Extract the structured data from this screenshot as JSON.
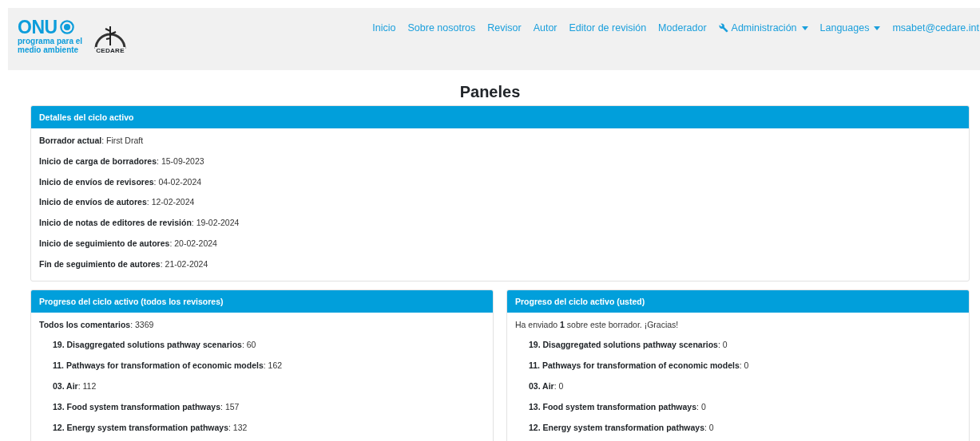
{
  "header": {
    "logo_primary": {
      "title": "ONU",
      "subtitle": "programa para el medio ambiente"
    },
    "logo_secondary": {
      "caption": "CEDARE"
    },
    "nav": [
      {
        "label": "Inicio",
        "kind": "link"
      },
      {
        "label": "Sobre nosotros",
        "kind": "link"
      },
      {
        "label": "Revisor",
        "kind": "link"
      },
      {
        "label": "Autor",
        "kind": "link"
      },
      {
        "label": "Editor de revisión",
        "kind": "link"
      },
      {
        "label": "Moderador",
        "kind": "link"
      },
      {
        "label": "Administración",
        "kind": "admin"
      },
      {
        "label": "Languages",
        "kind": "dropdown"
      },
      {
        "label": "msabet@cedare.int",
        "kind": "dropdown"
      }
    ]
  },
  "page_title": "Paneles",
  "cycle_details": {
    "title": "Detalles del ciclo activo",
    "rows": [
      "**Borrador actual**: First Draft",
      "**Inicio de carga de borradores**: 15-09-2023",
      "**Inicio de envíos de revisores**: 04-02-2024",
      "**Inicio de envíos de autores**: 12-02-2024",
      "**Inicio de notas de editores de revisión**: 19-02-2024",
      "**Inicio de seguimiento de autores**: 20-02-2024",
      "**Fin de seguimiento de autores**: 21-02-2024"
    ]
  },
  "progress_panels": [
    {
      "title": "Progreso del ciclo activo (todos los revisores)",
      "summary": "**Todos los comentarios**: 3369",
      "chapters": [
        "**19. Disaggregated solutions pathway scenarios**: 60",
        "**11. Pathways for transformation of economic models**: 162",
        "**03. Air**: 112",
        "**13. Food system transformation pathways**: 157",
        "**12. Energy system transformation pathways**: 132"
      ]
    },
    {
      "title": "Progreso del ciclo activo (usted)",
      "summary": "Ha enviado **1** sobre este borrador. ¡Gracias!",
      "chapters": [
        "**19. Disaggregated solutions pathway scenarios**: 0",
        "**11. Pathways for transformation of economic models**: 0",
        "**03. Air**: 0",
        "**13. Food system transformation pathways**: 0",
        "**12. Energy system transformation pathways**: 0"
      ]
    }
  ]
}
